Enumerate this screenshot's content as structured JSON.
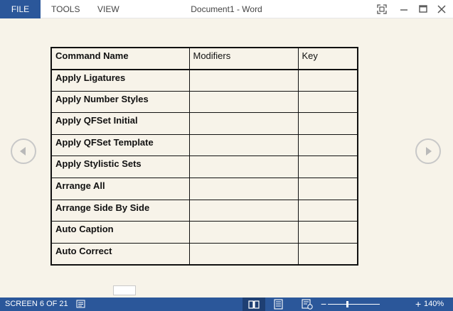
{
  "titlebar": {
    "menu": {
      "file": "FILE",
      "tools": "TOOLS",
      "view": "VIEW"
    },
    "document_title": "Document1 - Word"
  },
  "table": {
    "headers": [
      "Command Name",
      "Modifiers",
      "Key"
    ],
    "rows": [
      [
        "Apply Ligatures",
        "",
        ""
      ],
      [
        "Apply Number Styles",
        "",
        ""
      ],
      [
        "Apply QFSet Initial",
        "",
        ""
      ],
      [
        "Apply QFSet Template",
        "",
        ""
      ],
      [
        "Apply Stylistic Sets",
        "",
        ""
      ],
      [
        "Arrange All",
        "",
        ""
      ],
      [
        "Arrange Side By Side",
        "",
        ""
      ],
      [
        "Auto Caption",
        "",
        ""
      ],
      [
        "Auto Correct",
        "",
        ""
      ]
    ]
  },
  "statusbar": {
    "screen": "SCREEN 6 OF 21",
    "zoom_minus": "−",
    "zoom_plus": "+",
    "zoom_value": "140%",
    "active_view": "read-mode"
  },
  "colors": {
    "accent": "#2b579a",
    "page_background": "#f7f3e9"
  },
  "icons": {
    "window": [
      "fullscreen-icon",
      "minimize-icon",
      "restore-icon",
      "close-icon"
    ],
    "navigation": [
      "previous-screen-icon",
      "next-screen-icon"
    ],
    "status": [
      "comments-icon",
      "read-mode-icon",
      "print-layout-icon",
      "web-layout-icon"
    ]
  }
}
